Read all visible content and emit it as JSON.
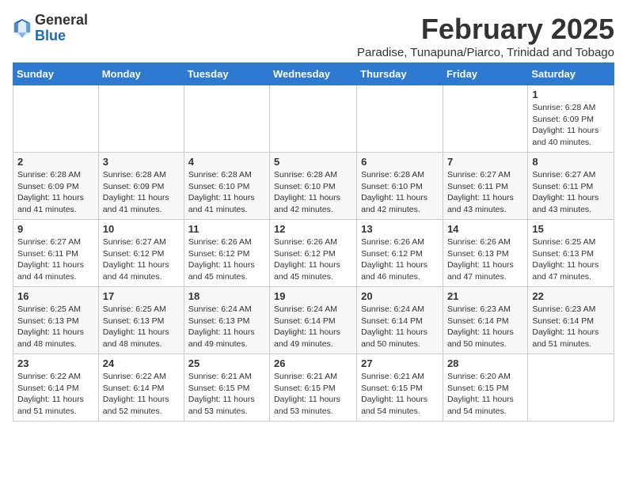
{
  "logo": {
    "general": "General",
    "blue": "Blue"
  },
  "header": {
    "title": "February 2025",
    "subtitle": "Paradise, Tunapuna/Piarco, Trinidad and Tobago"
  },
  "weekdays": [
    "Sunday",
    "Monday",
    "Tuesday",
    "Wednesday",
    "Thursday",
    "Friday",
    "Saturday"
  ],
  "weeks": [
    [
      {
        "day": "",
        "info": ""
      },
      {
        "day": "",
        "info": ""
      },
      {
        "day": "",
        "info": ""
      },
      {
        "day": "",
        "info": ""
      },
      {
        "day": "",
        "info": ""
      },
      {
        "day": "",
        "info": ""
      },
      {
        "day": "1",
        "info": "Sunrise: 6:28 AM\nSunset: 6:09 PM\nDaylight: 11 hours\nand 40 minutes."
      }
    ],
    [
      {
        "day": "2",
        "info": "Sunrise: 6:28 AM\nSunset: 6:09 PM\nDaylight: 11 hours\nand 41 minutes."
      },
      {
        "day": "3",
        "info": "Sunrise: 6:28 AM\nSunset: 6:09 PM\nDaylight: 11 hours\nand 41 minutes."
      },
      {
        "day": "4",
        "info": "Sunrise: 6:28 AM\nSunset: 6:10 PM\nDaylight: 11 hours\nand 41 minutes."
      },
      {
        "day": "5",
        "info": "Sunrise: 6:28 AM\nSunset: 6:10 PM\nDaylight: 11 hours\nand 42 minutes."
      },
      {
        "day": "6",
        "info": "Sunrise: 6:28 AM\nSunset: 6:10 PM\nDaylight: 11 hours\nand 42 minutes."
      },
      {
        "day": "7",
        "info": "Sunrise: 6:27 AM\nSunset: 6:11 PM\nDaylight: 11 hours\nand 43 minutes."
      },
      {
        "day": "8",
        "info": "Sunrise: 6:27 AM\nSunset: 6:11 PM\nDaylight: 11 hours\nand 43 minutes."
      }
    ],
    [
      {
        "day": "9",
        "info": "Sunrise: 6:27 AM\nSunset: 6:11 PM\nDaylight: 11 hours\nand 44 minutes."
      },
      {
        "day": "10",
        "info": "Sunrise: 6:27 AM\nSunset: 6:12 PM\nDaylight: 11 hours\nand 44 minutes."
      },
      {
        "day": "11",
        "info": "Sunrise: 6:26 AM\nSunset: 6:12 PM\nDaylight: 11 hours\nand 45 minutes."
      },
      {
        "day": "12",
        "info": "Sunrise: 6:26 AM\nSunset: 6:12 PM\nDaylight: 11 hours\nand 45 minutes."
      },
      {
        "day": "13",
        "info": "Sunrise: 6:26 AM\nSunset: 6:12 PM\nDaylight: 11 hours\nand 46 minutes."
      },
      {
        "day": "14",
        "info": "Sunrise: 6:26 AM\nSunset: 6:13 PM\nDaylight: 11 hours\nand 47 minutes."
      },
      {
        "day": "15",
        "info": "Sunrise: 6:25 AM\nSunset: 6:13 PM\nDaylight: 11 hours\nand 47 minutes."
      }
    ],
    [
      {
        "day": "16",
        "info": "Sunrise: 6:25 AM\nSunset: 6:13 PM\nDaylight: 11 hours\nand 48 minutes."
      },
      {
        "day": "17",
        "info": "Sunrise: 6:25 AM\nSunset: 6:13 PM\nDaylight: 11 hours\nand 48 minutes."
      },
      {
        "day": "18",
        "info": "Sunrise: 6:24 AM\nSunset: 6:13 PM\nDaylight: 11 hours\nand 49 minutes."
      },
      {
        "day": "19",
        "info": "Sunrise: 6:24 AM\nSunset: 6:14 PM\nDaylight: 11 hours\nand 49 minutes."
      },
      {
        "day": "20",
        "info": "Sunrise: 6:24 AM\nSunset: 6:14 PM\nDaylight: 11 hours\nand 50 minutes."
      },
      {
        "day": "21",
        "info": "Sunrise: 6:23 AM\nSunset: 6:14 PM\nDaylight: 11 hours\nand 50 minutes."
      },
      {
        "day": "22",
        "info": "Sunrise: 6:23 AM\nSunset: 6:14 PM\nDaylight: 11 hours\nand 51 minutes."
      }
    ],
    [
      {
        "day": "23",
        "info": "Sunrise: 6:22 AM\nSunset: 6:14 PM\nDaylight: 11 hours\nand 51 minutes."
      },
      {
        "day": "24",
        "info": "Sunrise: 6:22 AM\nSunset: 6:14 PM\nDaylight: 11 hours\nand 52 minutes."
      },
      {
        "day": "25",
        "info": "Sunrise: 6:21 AM\nSunset: 6:15 PM\nDaylight: 11 hours\nand 53 minutes."
      },
      {
        "day": "26",
        "info": "Sunrise: 6:21 AM\nSunset: 6:15 PM\nDaylight: 11 hours\nand 53 minutes."
      },
      {
        "day": "27",
        "info": "Sunrise: 6:21 AM\nSunset: 6:15 PM\nDaylight: 11 hours\nand 54 minutes."
      },
      {
        "day": "28",
        "info": "Sunrise: 6:20 AM\nSunset: 6:15 PM\nDaylight: 11 hours\nand 54 minutes."
      },
      {
        "day": "",
        "info": ""
      }
    ]
  ]
}
